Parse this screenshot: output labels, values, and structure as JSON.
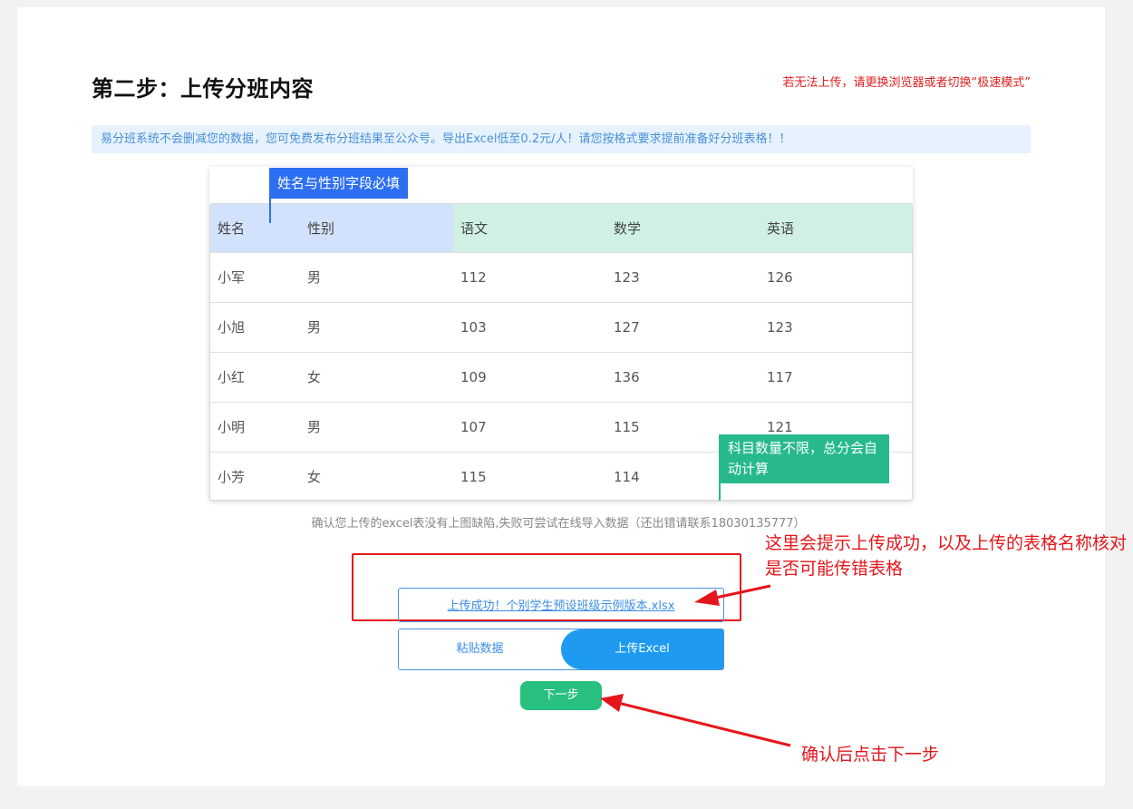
{
  "header": {
    "step_title": "第二步：上传分班内容",
    "browser_hint": "若无法上传，请更换浏览器或者切换“极速模式”"
  },
  "banner": {
    "text": "易分班系统不会删减您的数据，您可免费发布分班结果至公众号。导出Excel低至0.2元/人！请您按格式要求提前准备好分班表格！！"
  },
  "sample_table": {
    "headers": [
      "姓名",
      "性别",
      "语文",
      "数学",
      "英语"
    ],
    "rows": [
      [
        "小军",
        "男",
        "112",
        "123",
        "126"
      ],
      [
        "小旭",
        "男",
        "103",
        "127",
        "123"
      ],
      [
        "小红",
        "女",
        "109",
        "136",
        "117"
      ],
      [
        "小明",
        "男",
        "107",
        "115",
        "121"
      ],
      [
        "小芳",
        "女",
        "115",
        "114",
        ""
      ]
    ],
    "callout_required": "姓名与性别字段必填",
    "callout_subjects": "科目数量不限，总分会自动计算"
  },
  "confirm_note": "确认您上传的excel表没有上图缺陷,失败可尝试在线导入数据（还出错请联系18030135777）",
  "upload": {
    "success_link": "上传成功！个别学生预设班级示例版本.xlsx",
    "paste_label": "粘贴数据",
    "upload_label": "上传Excel"
  },
  "next_label": "下一步",
  "annotations": {
    "upload_hint": "这里会提示上传成功，以及上传的表格名称核对是否可能传错表格",
    "next_hint": "确认后点击下一步"
  },
  "colors": {
    "accent_blue": "#1e9bf0",
    "next_green": "#27c07f",
    "annotation_red": "#e5161b"
  }
}
